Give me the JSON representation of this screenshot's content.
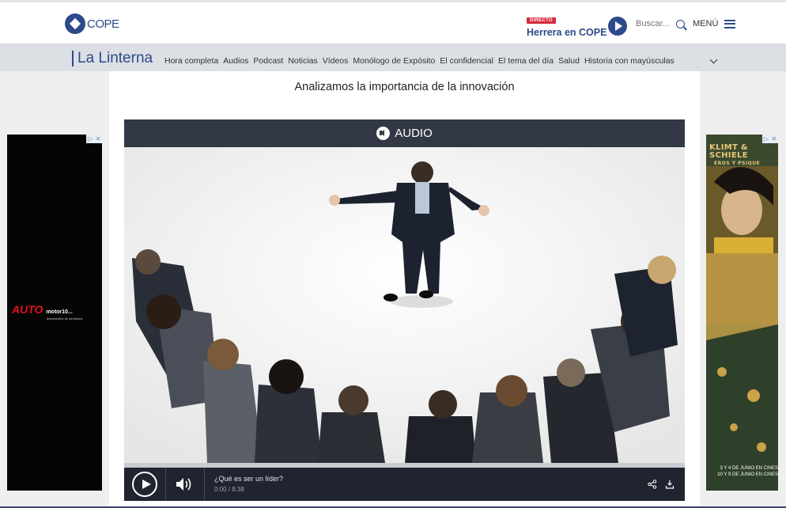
{
  "header": {
    "logo_text": "COPE",
    "live_badge": "DIRECTO",
    "live_title": "Herrera en COPE",
    "search_label": "Buscar...",
    "menu_label": "MENÚ"
  },
  "subnav": {
    "program": "La Linterna",
    "links": [
      "Hora completa",
      "Audios",
      "Podcast",
      "Noticias",
      "Vídeos",
      "Monólogo de Expósito",
      "El confidencial",
      "El tema del día",
      "Salud",
      "Historia con mayúsculas"
    ]
  },
  "article": {
    "subtitle": "Analizamos la importancia de la innovación"
  },
  "player": {
    "header_label": "AUDIO",
    "track_title": "¿Qué es ser un líder?",
    "time": "0:00 / 8:38",
    "progress": 0
  },
  "ads": {
    "left_brand": "AUTO",
    "left_brand_small": "motor10...",
    "left_tagline": "automóviles de confianza",
    "right_title": "KLIMT & SCHIELE",
    "right_subtitle": "EROS Y PSIQUE",
    "right_dates_1": "3 Y 4 DE JUNIO EN CINES",
    "right_dates_2": "10 Y 9 DE JUNIO EN CINES"
  },
  "colors": {
    "brand": "#2d4a8a",
    "live_red": "#d8283c",
    "player_dark": "#1f2430"
  }
}
